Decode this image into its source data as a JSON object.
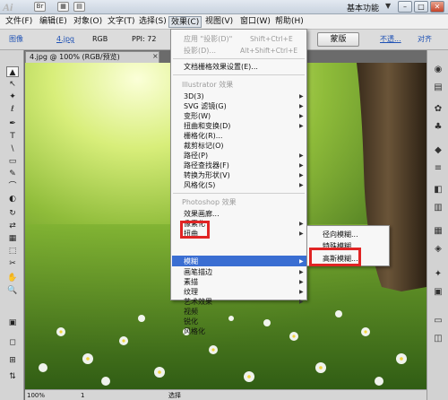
{
  "app": {
    "logo": "Ai",
    "workspace": "基本功能",
    "workspace_arrow": "▼"
  },
  "titlebar": {
    "tb_icon_1": "Br",
    "tb_icon_2": "▦",
    "tb_icon_3": "▤"
  },
  "window_buttons": {
    "minimize": "–",
    "maximize": "□",
    "close": "✕"
  },
  "menubar": {
    "items": [
      "文件(F)",
      "编辑(E)",
      "对象(O)",
      "文字(T)",
      "选择(S)",
      "效果(C)",
      "视图(V)",
      "窗口(W)",
      "帮助(H)"
    ]
  },
  "control_bar": {
    "image_label": "图像",
    "file_name": "4.jpg",
    "color_mode": "RGB",
    "ppi": "PPI: 72",
    "button_label": "蒙版",
    "opacity_label": "不透...",
    "align_label": "对齐"
  },
  "document": {
    "tab_title": "4.jpg @ 100% (RGB/预览)",
    "close": "×"
  },
  "status_bar": {
    "zoom": "100%",
    "page": "1",
    "tool": "选择"
  },
  "toolbar": {
    "tool_icons": [
      "▲",
      "↖",
      "✦",
      "ℓ",
      "✒",
      "T",
      "\\",
      "▭",
      "✎",
      "⌒",
      "◐",
      "↻",
      "⇄",
      "▦",
      "⬚",
      "✂",
      "✋",
      "🔍",
      "▣",
      "◻",
      "⊞",
      "⇅"
    ]
  },
  "right_panel": {
    "icons": [
      "◉",
      "▤",
      "✿",
      "♣",
      "◆",
      "≡",
      "◧",
      "▥",
      "▦",
      "◈",
      "✦",
      "▣",
      "▭",
      "◫"
    ]
  },
  "effects_menu": {
    "apply_last": {
      "label": "应用 \"投影(D)\"",
      "shortcut": "Shift+Ctrl+E"
    },
    "last_effect": {
      "label": "投影(D)...",
      "shortcut": "Alt+Shift+Ctrl+E"
    },
    "doc_raster_settings": "文档栅格效果设置(E)...",
    "illustrator_section": "Illustrator 效果",
    "illustrator_items": [
      "3D(3)",
      "SVG 滤镜(G)",
      "变形(W)",
      "扭曲和变换(D)",
      "栅格化(R)...",
      "裁剪标记(O)",
      "路径(P)",
      "路径查找器(F)",
      "转换为形状(V)",
      "风格化(S)"
    ],
    "photoshop_section": "Photoshop 效果",
    "photoshop_items": [
      "效果画廊...",
      "像素化",
      "扭曲",
      "模糊",
      "画笔描边",
      "素描",
      "纹理",
      "艺术效果",
      "视频",
      "锐化",
      "风格化"
    ]
  },
  "blur_submenu": {
    "items": [
      "径向模糊...",
      "特殊模糊...",
      "高斯模糊..."
    ]
  }
}
